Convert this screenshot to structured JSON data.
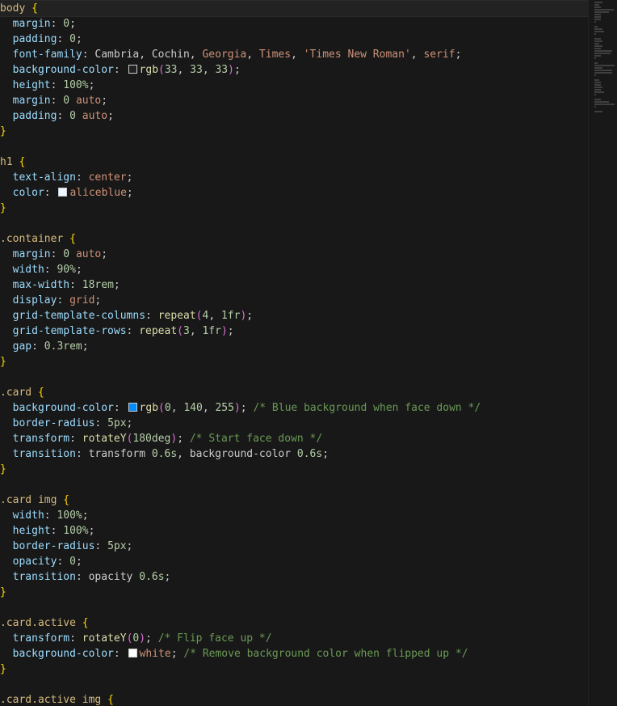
{
  "colors": {
    "background": "#181818",
    "selector": "#d7ba7d",
    "property": "#9cdcfe",
    "number": "#b5cea8",
    "keyword": "#ce9178",
    "comment": "#6a9955",
    "brace": "#ffd700",
    "function": "#dcdcaa",
    "paren": "#da70d6"
  },
  "lines": [
    [
      [
        "sel",
        "body"
      ],
      [
        "plain",
        " "
      ],
      [
        "brace",
        "{"
      ]
    ],
    [
      [
        "plain",
        "  "
      ],
      [
        "prop",
        "margin"
      ],
      [
        "plain",
        ": "
      ],
      [
        "num",
        "0"
      ],
      [
        "plain",
        ";"
      ]
    ],
    [
      [
        "plain",
        "  "
      ],
      [
        "prop",
        "padding"
      ],
      [
        "plain",
        ": "
      ],
      [
        "num",
        "0"
      ],
      [
        "plain",
        ";"
      ]
    ],
    [
      [
        "plain",
        "  "
      ],
      [
        "prop",
        "font-family"
      ],
      [
        "plain",
        ": Cambria, Cochin, "
      ],
      [
        "kw",
        "Georgia"
      ],
      [
        "plain",
        ", "
      ],
      [
        "kw",
        "Times"
      ],
      [
        "plain",
        ", "
      ],
      [
        "str",
        "'Times New Roman'"
      ],
      [
        "plain",
        ", "
      ],
      [
        "kw",
        "serif"
      ],
      [
        "plain",
        ";"
      ]
    ],
    [
      [
        "plain",
        "  "
      ],
      [
        "prop",
        "background-color"
      ],
      [
        "plain",
        ": "
      ],
      [
        "swatch",
        "#212121"
      ],
      [
        "fn",
        "rgb"
      ],
      [
        "paren",
        "("
      ],
      [
        "num",
        "33"
      ],
      [
        "plain",
        ", "
      ],
      [
        "num",
        "33"
      ],
      [
        "plain",
        ", "
      ],
      [
        "num",
        "33"
      ],
      [
        "paren",
        ")"
      ],
      [
        "plain",
        ";"
      ]
    ],
    [
      [
        "plain",
        "  "
      ],
      [
        "prop",
        "height"
      ],
      [
        "plain",
        ": "
      ],
      [
        "num",
        "100%"
      ],
      [
        "plain",
        ";"
      ]
    ],
    [
      [
        "plain",
        "  "
      ],
      [
        "prop",
        "margin"
      ],
      [
        "plain",
        ": "
      ],
      [
        "num",
        "0"
      ],
      [
        "plain",
        " "
      ],
      [
        "kw",
        "auto"
      ],
      [
        "plain",
        ";"
      ]
    ],
    [
      [
        "plain",
        "  "
      ],
      [
        "prop",
        "padding"
      ],
      [
        "plain",
        ": "
      ],
      [
        "num",
        "0"
      ],
      [
        "plain",
        " "
      ],
      [
        "kw",
        "auto"
      ],
      [
        "plain",
        ";"
      ]
    ],
    [
      [
        "brace",
        "}"
      ]
    ],
    [],
    [
      [
        "sel",
        "h1"
      ],
      [
        "plain",
        " "
      ],
      [
        "brace",
        "{"
      ]
    ],
    [
      [
        "plain",
        "  "
      ],
      [
        "prop",
        "text-align"
      ],
      [
        "plain",
        ": "
      ],
      [
        "kw",
        "center"
      ],
      [
        "plain",
        ";"
      ]
    ],
    [
      [
        "plain",
        "  "
      ],
      [
        "prop",
        "color"
      ],
      [
        "plain",
        ": "
      ],
      [
        "swatch",
        "#f0f8ff"
      ],
      [
        "kw",
        "aliceblue"
      ],
      [
        "plain",
        ";"
      ]
    ],
    [
      [
        "brace",
        "}"
      ]
    ],
    [],
    [
      [
        "sel",
        ".container"
      ],
      [
        "plain",
        " "
      ],
      [
        "brace",
        "{"
      ]
    ],
    [
      [
        "plain",
        "  "
      ],
      [
        "prop",
        "margin"
      ],
      [
        "plain",
        ": "
      ],
      [
        "num",
        "0"
      ],
      [
        "plain",
        " "
      ],
      [
        "kw",
        "auto"
      ],
      [
        "plain",
        ";"
      ]
    ],
    [
      [
        "plain",
        "  "
      ],
      [
        "prop",
        "width"
      ],
      [
        "plain",
        ": "
      ],
      [
        "num",
        "90%"
      ],
      [
        "plain",
        ";"
      ]
    ],
    [
      [
        "plain",
        "  "
      ],
      [
        "prop",
        "max-width"
      ],
      [
        "plain",
        ": "
      ],
      [
        "num",
        "18rem"
      ],
      [
        "plain",
        ";"
      ]
    ],
    [
      [
        "plain",
        "  "
      ],
      [
        "prop",
        "display"
      ],
      [
        "plain",
        ": "
      ],
      [
        "kw",
        "grid"
      ],
      [
        "plain",
        ";"
      ]
    ],
    [
      [
        "plain",
        "  "
      ],
      [
        "prop",
        "grid-template-columns"
      ],
      [
        "plain",
        ": "
      ],
      [
        "fn",
        "repeat"
      ],
      [
        "paren",
        "("
      ],
      [
        "num",
        "4"
      ],
      [
        "plain",
        ", "
      ],
      [
        "num",
        "1fr"
      ],
      [
        "paren",
        ")"
      ],
      [
        "plain",
        ";"
      ]
    ],
    [
      [
        "plain",
        "  "
      ],
      [
        "prop",
        "grid-template-rows"
      ],
      [
        "plain",
        ": "
      ],
      [
        "fn",
        "repeat"
      ],
      [
        "paren",
        "("
      ],
      [
        "num",
        "3"
      ],
      [
        "plain",
        ", "
      ],
      [
        "num",
        "1fr"
      ],
      [
        "paren",
        ")"
      ],
      [
        "plain",
        ";"
      ]
    ],
    [
      [
        "plain",
        "  "
      ],
      [
        "prop",
        "gap"
      ],
      [
        "plain",
        ": "
      ],
      [
        "num",
        "0.3rem"
      ],
      [
        "plain",
        ";"
      ]
    ],
    [
      [
        "brace",
        "}"
      ]
    ],
    [],
    [
      [
        "sel",
        ".card"
      ],
      [
        "plain",
        " "
      ],
      [
        "brace",
        "{"
      ]
    ],
    [
      [
        "plain",
        "  "
      ],
      [
        "prop",
        "background-color"
      ],
      [
        "plain",
        ": "
      ],
      [
        "swatch",
        "#008cff"
      ],
      [
        "fn",
        "rgb"
      ],
      [
        "paren",
        "("
      ],
      [
        "num",
        "0"
      ],
      [
        "plain",
        ", "
      ],
      [
        "num",
        "140"
      ],
      [
        "plain",
        ", "
      ],
      [
        "num",
        "255"
      ],
      [
        "paren",
        ")"
      ],
      [
        "plain",
        "; "
      ],
      [
        "cmt",
        "/* Blue background when face down */"
      ]
    ],
    [
      [
        "plain",
        "  "
      ],
      [
        "prop",
        "border-radius"
      ],
      [
        "plain",
        ": "
      ],
      [
        "num",
        "5px"
      ],
      [
        "plain",
        ";"
      ]
    ],
    [
      [
        "plain",
        "  "
      ],
      [
        "prop",
        "transform"
      ],
      [
        "plain",
        ": "
      ],
      [
        "fn",
        "rotateY"
      ],
      [
        "paren",
        "("
      ],
      [
        "num",
        "180deg"
      ],
      [
        "paren",
        ")"
      ],
      [
        "plain",
        "; "
      ],
      [
        "cmt",
        "/* Start face down */"
      ]
    ],
    [
      [
        "plain",
        "  "
      ],
      [
        "prop",
        "transition"
      ],
      [
        "plain",
        ": transform "
      ],
      [
        "num",
        "0.6s"
      ],
      [
        "plain",
        ", background-color "
      ],
      [
        "num",
        "0.6s"
      ],
      [
        "plain",
        ";"
      ]
    ],
    [
      [
        "brace",
        "}"
      ]
    ],
    [],
    [
      [
        "sel",
        ".card img"
      ],
      [
        "plain",
        " "
      ],
      [
        "brace",
        "{"
      ]
    ],
    [
      [
        "plain",
        "  "
      ],
      [
        "prop",
        "width"
      ],
      [
        "plain",
        ": "
      ],
      [
        "num",
        "100%"
      ],
      [
        "plain",
        ";"
      ]
    ],
    [
      [
        "plain",
        "  "
      ],
      [
        "prop",
        "height"
      ],
      [
        "plain",
        ": "
      ],
      [
        "num",
        "100%"
      ],
      [
        "plain",
        ";"
      ]
    ],
    [
      [
        "plain",
        "  "
      ],
      [
        "prop",
        "border-radius"
      ],
      [
        "plain",
        ": "
      ],
      [
        "num",
        "5px"
      ],
      [
        "plain",
        ";"
      ]
    ],
    [
      [
        "plain",
        "  "
      ],
      [
        "prop",
        "opacity"
      ],
      [
        "plain",
        ": "
      ],
      [
        "num",
        "0"
      ],
      [
        "plain",
        ";"
      ]
    ],
    [
      [
        "plain",
        "  "
      ],
      [
        "prop",
        "transition"
      ],
      [
        "plain",
        ": opacity "
      ],
      [
        "num",
        "0.6s"
      ],
      [
        "plain",
        ";"
      ]
    ],
    [
      [
        "brace",
        "}"
      ]
    ],
    [],
    [
      [
        "sel",
        ".card.active"
      ],
      [
        "plain",
        " "
      ],
      [
        "brace",
        "{"
      ]
    ],
    [
      [
        "plain",
        "  "
      ],
      [
        "prop",
        "transform"
      ],
      [
        "plain",
        ": "
      ],
      [
        "fn",
        "rotateY"
      ],
      [
        "paren",
        "("
      ],
      [
        "num",
        "0"
      ],
      [
        "paren",
        ")"
      ],
      [
        "plain",
        "; "
      ],
      [
        "cmt",
        "/* Flip face up */"
      ]
    ],
    [
      [
        "plain",
        "  "
      ],
      [
        "prop",
        "background-color"
      ],
      [
        "plain",
        ": "
      ],
      [
        "swatch",
        "#ffffff"
      ],
      [
        "kw",
        "white"
      ],
      [
        "plain",
        "; "
      ],
      [
        "cmt",
        "/* Remove background color when flipped up */"
      ]
    ],
    [
      [
        "brace",
        "}"
      ]
    ],
    [],
    [
      [
        "sel",
        ".card.active img"
      ],
      [
        "plain",
        " "
      ],
      [
        "brace",
        "{"
      ]
    ]
  ],
  "minimap_lines": [
    10,
    6,
    8,
    24,
    18,
    8,
    8,
    8,
    2,
    0,
    4,
    10,
    12,
    2,
    0,
    8,
    10,
    6,
    10,
    8,
    22,
    20,
    8,
    2,
    0,
    4,
    25,
    10,
    22,
    22,
    2,
    0,
    6,
    8,
    8,
    10,
    8,
    12,
    2,
    0,
    8,
    18,
    25,
    2,
    0,
    10
  ]
}
